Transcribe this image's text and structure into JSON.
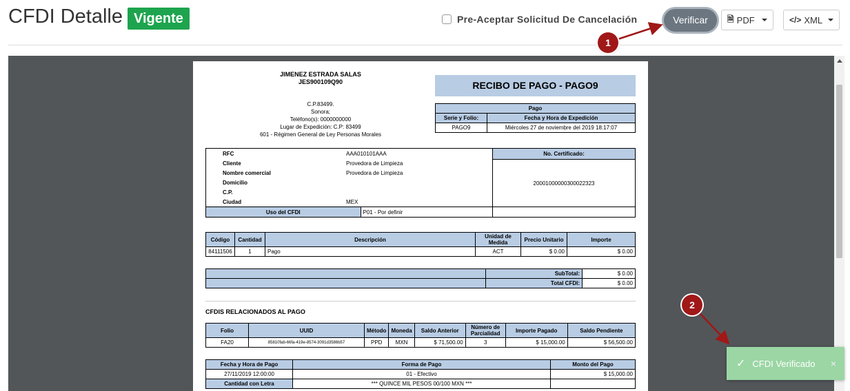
{
  "header": {
    "title": "CFDI Detalle",
    "status_badge": "Vigente",
    "preaccept_label": "Pre-Aceptar Solicitud De Cancelación",
    "verify_label": "Verificar",
    "pdf_label": "PDF",
    "xml_label": "XML"
  },
  "colors": {
    "badge": "#1ea44e",
    "verify": "#6b7680",
    "table_header": "#b8cce4",
    "step": "#a01818",
    "toast": "#9bd6a4"
  },
  "icons": {
    "pdf": "file-pdf-icon",
    "xml": "code-icon",
    "check": "check-icon",
    "close": "close-icon"
  },
  "doc": {
    "issuer_name": "JIMENEZ ESTRADA SALAS",
    "issuer_rfc": "JES900109Q90",
    "addr1": "C.P.83499.",
    "addr2": "Sonora;",
    "addr3": "Teléfono(s): 0000000000",
    "addr4": "Lugar de Expedición: C.P: 83499",
    "addr5": "601 - Régimen General de Ley Personas Morales",
    "title": "RECIBO DE PAGO - PAGO9",
    "pago_label": "Pago",
    "serie_label": "Serie y Folio:",
    "fecha_exp_label": "Fecha y Hora de Expedición",
    "serie_value": "PAGO9",
    "fecha_exp_value": "Miércoles 27 de noviembre del 2019 18:17:07",
    "rfc_label": "RFC",
    "rfc_value": "AAA010101AAA",
    "cliente_label": "Cliente",
    "cliente_value": "Provedora de Limpieza",
    "nombre_label": "Nombre comercial",
    "nombre_value": "Provedora de Limpieza",
    "domicilio_label": "Domicilio",
    "cp_label": "C.P.",
    "ciudad_label": "Ciudad",
    "ciudad_value": "MEX",
    "cert_label": "No. Certificado:",
    "cert_value": "20001000000300022323",
    "uso_label": "Uso del CFDI",
    "uso_value": "P01 - Por definir",
    "items_headers": [
      "Código",
      "Cantidad",
      "Descripción",
      "Unidad de Medida",
      "Precio Unitario",
      "Importe"
    ],
    "item": {
      "codigo": "84111506",
      "cantidad": "1",
      "descripcion": "Pago",
      "unidad": "ACT",
      "precio": "$ 0.00",
      "importe": "$ 0.00"
    },
    "subtotal_label": "SubTotal:",
    "subtotal_value": "$ 0.00",
    "total_label": "Total CFDI:",
    "total_value": "$ 0.00",
    "rel_title": "CFDIS RELACIONADOS AL PAGO",
    "rel_headers": [
      "Folio",
      "UUID",
      "Método",
      "Moneda",
      "Saldo Anterior",
      "Número de Parcialidad",
      "Importe Pagado",
      "Saldo Pendiente"
    ],
    "rel": {
      "folio": "FA20",
      "uuid": "85810fab-66fa-419e-8574-3091d3586b57",
      "metodo": "PPD",
      "moneda": "MXN",
      "saldo_ant": "$ 71,500.00",
      "parc": "3",
      "importe": "$ 15,000.00",
      "saldo_pend": "$ 56,500.00"
    },
    "pago_headers": [
      "Fecha y Hora de Pago",
      "Forma de Pago",
      "Monto del Pago"
    ],
    "pago": {
      "fecha": "27/11/2019 12:00:00",
      "forma": "01 - Efectivo",
      "monto": "$ 15,000.00"
    },
    "cantidad_letra_label": "Cantidad con Letra",
    "cantidad_letra_value": "*** QUINCE MIL PESOS 00/100 MXN ***"
  },
  "annotations": {
    "step1": "1",
    "step2": "2"
  },
  "toast": {
    "message": "CFDI Verificado",
    "close": "×"
  }
}
